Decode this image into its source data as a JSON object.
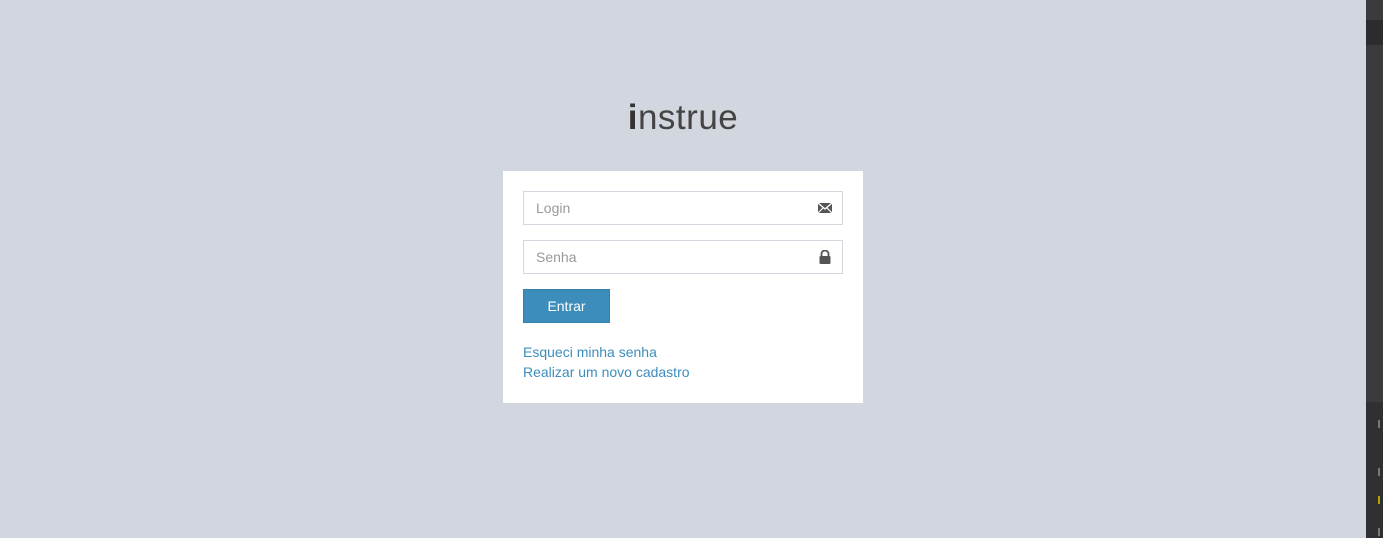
{
  "brand": {
    "logo_bold": "i",
    "logo_rest": "nstrue"
  },
  "form": {
    "login": {
      "placeholder": "Login",
      "value": "",
      "icon": "envelope-icon"
    },
    "senha": {
      "placeholder": "Senha",
      "value": "",
      "icon": "lock-icon"
    },
    "submit_label": "Entrar"
  },
  "links": {
    "forgot_password": "Esqueci minha senha",
    "register": "Realizar um novo cadastro"
  },
  "colors": {
    "page_background": "#d2d6de",
    "primary": "#3c8dbc",
    "box_background": "#ffffff"
  }
}
